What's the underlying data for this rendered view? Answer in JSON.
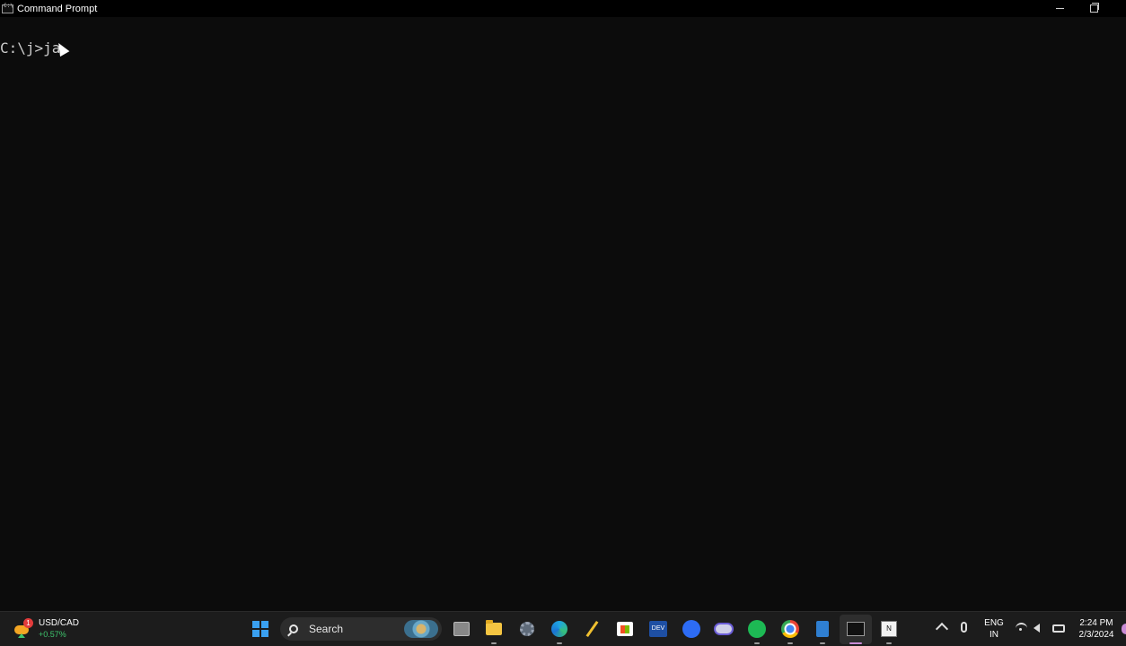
{
  "window": {
    "title": "Command Prompt"
  },
  "console": {
    "prompt": "C:\\j>",
    "typed": "ja"
  },
  "taskbar": {
    "widget": {
      "title": "USD/CAD",
      "change": "+0.57%",
      "badge": "1",
      "icon": "weather-finance-icon"
    },
    "search": {
      "label": "Search"
    },
    "apps": [
      {
        "name": "task-view"
      },
      {
        "name": "file-explorer"
      },
      {
        "name": "settings"
      },
      {
        "name": "edge"
      },
      {
        "name": "pen-app"
      },
      {
        "name": "microsoft-store"
      },
      {
        "name": "dev-app",
        "label": "DEV"
      },
      {
        "name": "zoom"
      },
      {
        "name": "app"
      },
      {
        "name": "spotify"
      },
      {
        "name": "chrome"
      },
      {
        "name": "notepad"
      },
      {
        "name": "command-prompt",
        "active": true
      },
      {
        "name": "notion",
        "label": "N"
      }
    ],
    "tray": {
      "language_line1": "ENG",
      "language_line2": "IN",
      "time": "2:24 PM",
      "date": "2/3/2024"
    }
  },
  "colors": {
    "console_bg": "#0c0c0c",
    "taskbar_bg": "#1c1c1c",
    "accent": "#c98bd6"
  }
}
